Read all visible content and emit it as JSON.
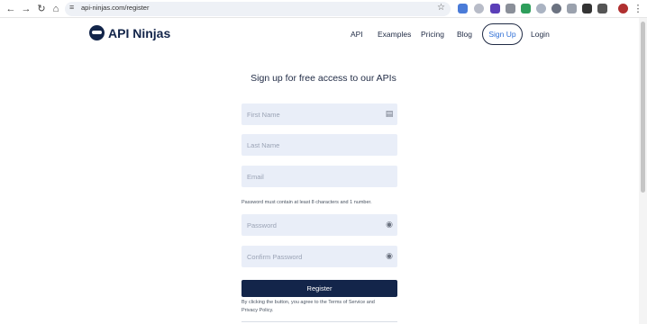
{
  "browser": {
    "url": "api-ninjas.com/register"
  },
  "site": {
    "logo": "API Ninjas",
    "nav": [
      "API",
      "Examples",
      "Pricing",
      "Blog"
    ],
    "signup": "Sign Up",
    "login": "Login"
  },
  "form": {
    "heading": "Sign up for free access to our APIs",
    "first_name_placeholder": "First Name",
    "last_name_placeholder": "Last Name",
    "email_placeholder": "Email",
    "password_hint": "Password must contain at least 8 characters and 1 number.",
    "password_placeholder": "Password",
    "confirm_password_placeholder": "Confirm Password",
    "register_label": "Register",
    "terms_line1": "By clicking the button, you agree to the Terms of Service and",
    "terms_line2": "Privacy Policy."
  },
  "icons": {
    "back": "arrow-left-icon",
    "forward": "arrow-right-icon",
    "reload": "reload-icon",
    "home": "home-icon",
    "site_info": "tune-icon",
    "bookmark": "star-icon",
    "autofill": "clipboard-icon",
    "password_toggle": "eye-icon"
  },
  "colors": {
    "brand": "#13254a",
    "field_bg": "#e9eef8",
    "link_blue": "#2f6fd6"
  }
}
